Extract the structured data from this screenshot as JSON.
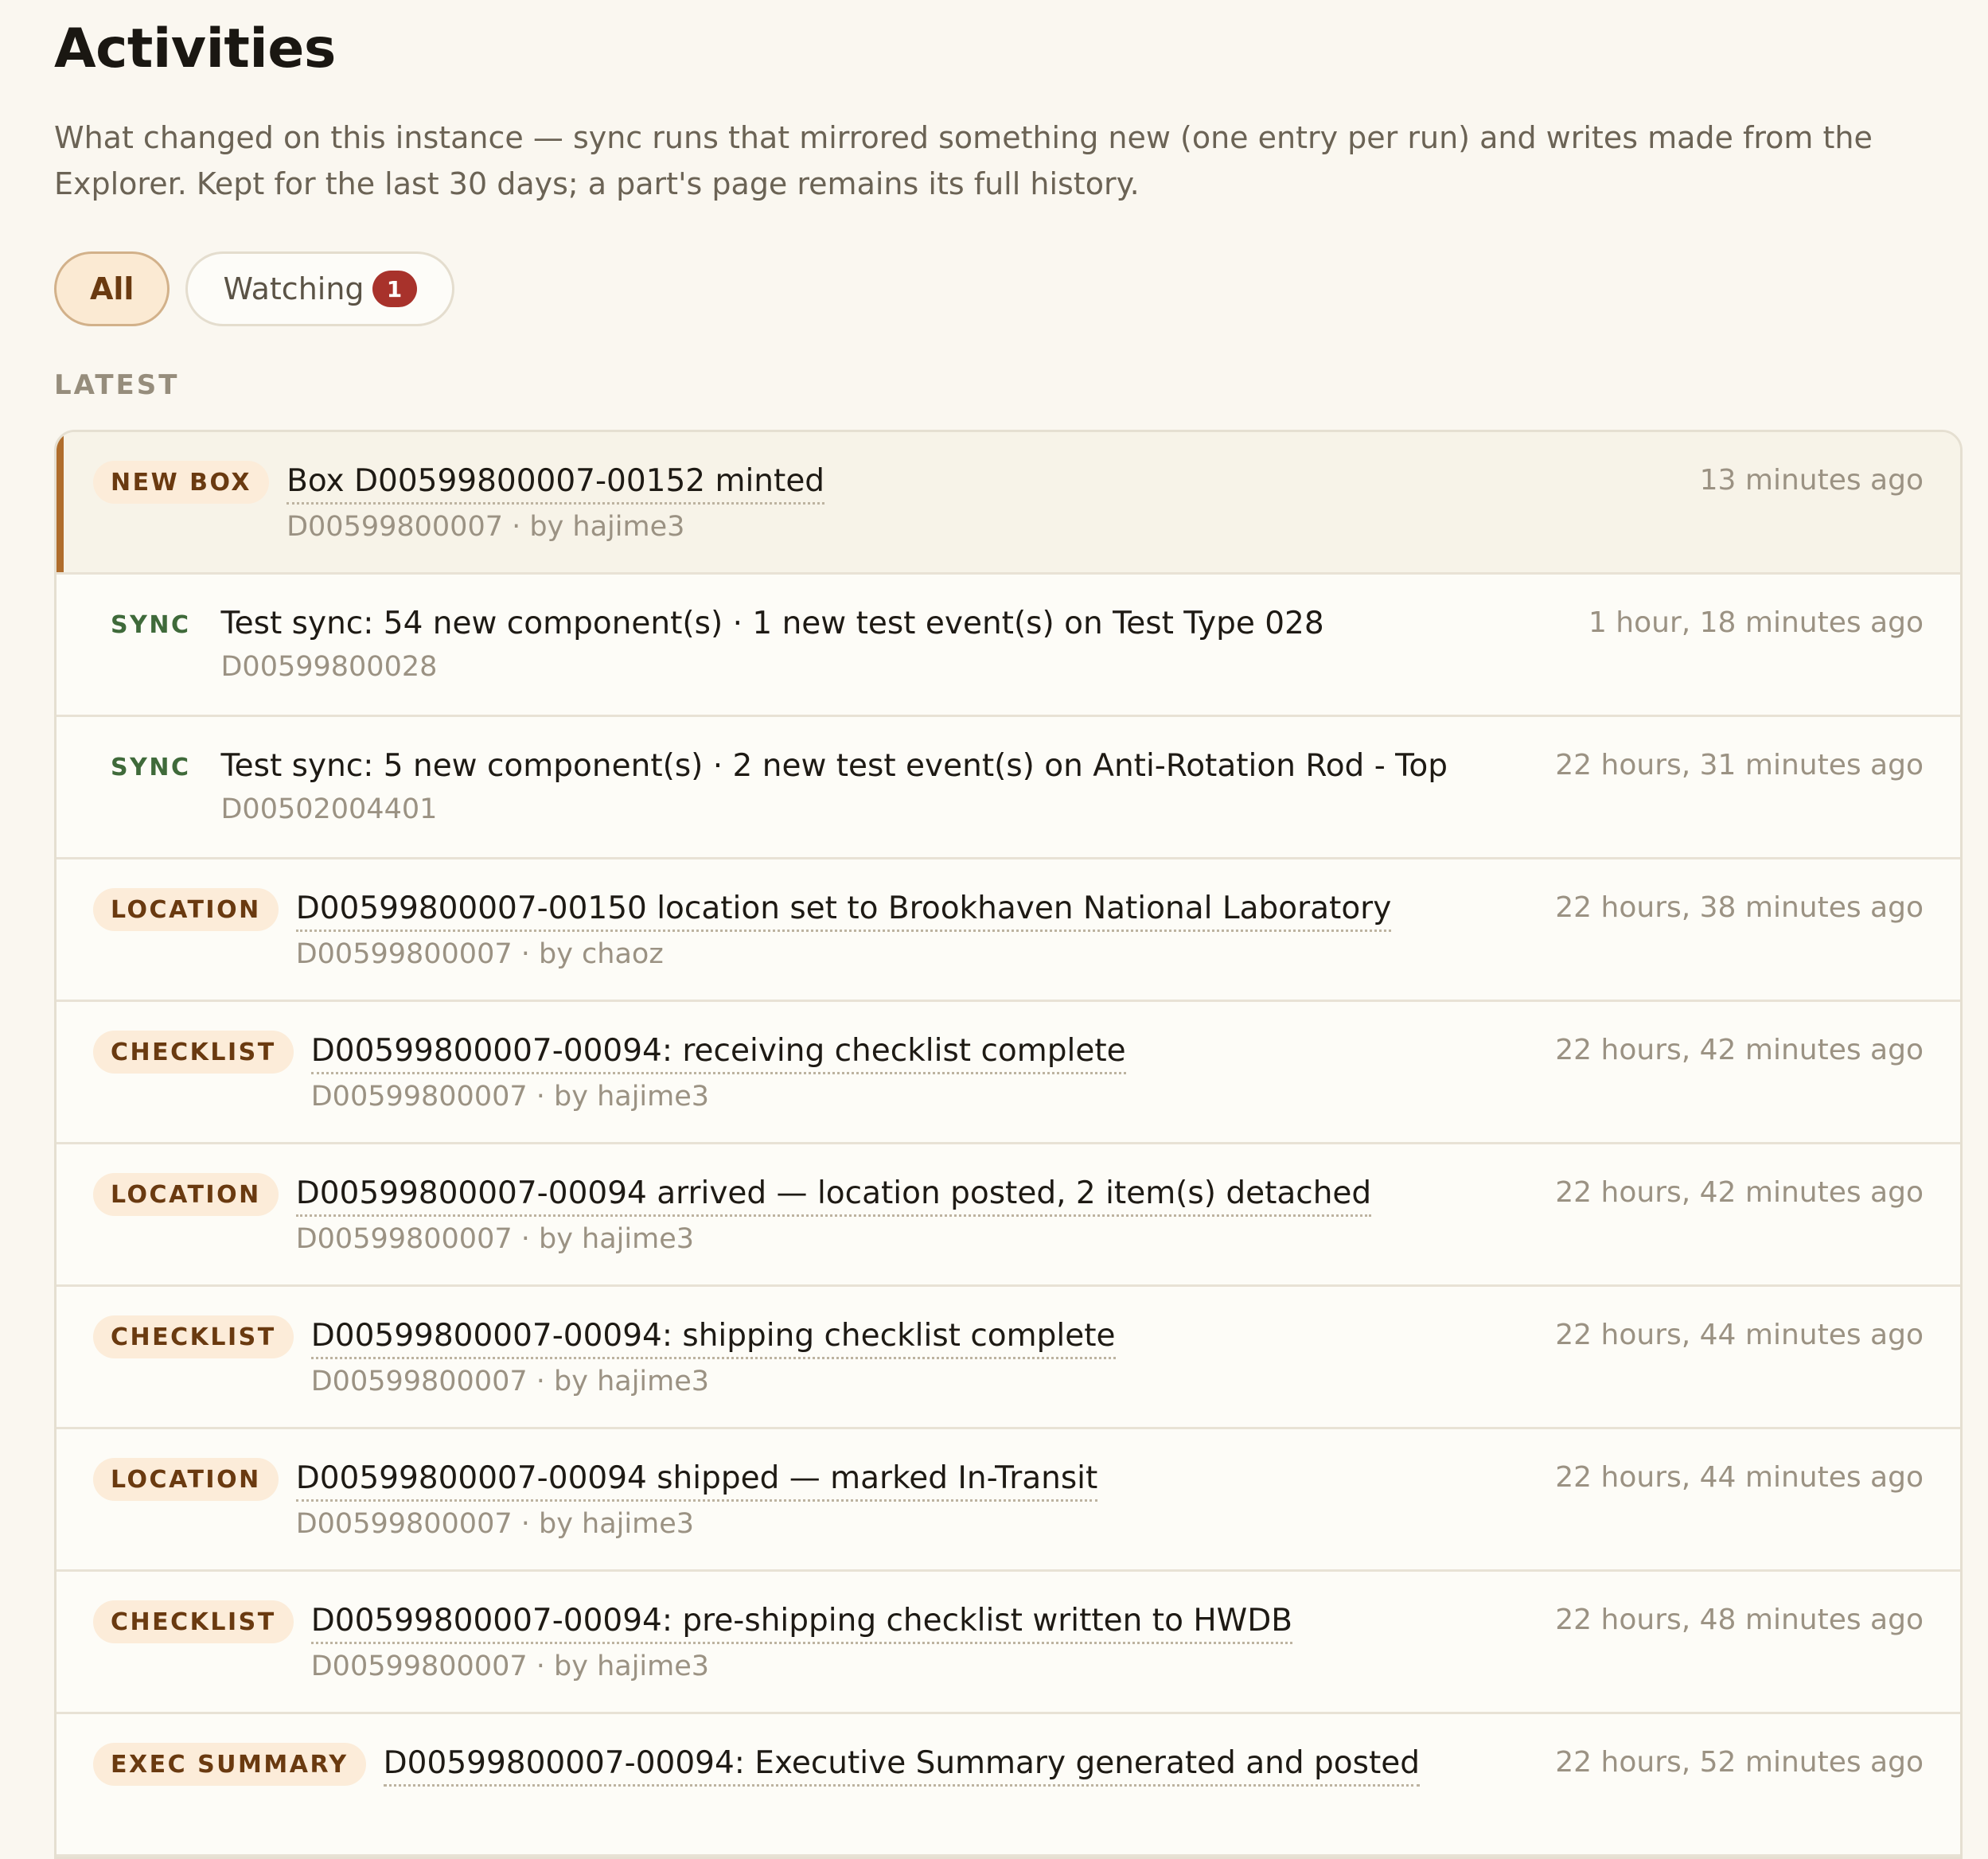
{
  "page": {
    "title": "Activities",
    "description": "What changed on this instance — sync runs that mirrored something new (one entry per run) and writes made from the Explorer. Kept for the last 30 days; a part's page remains its full history."
  },
  "filters": {
    "all_label": "All",
    "watching_label": "Watching",
    "watching_count": "1"
  },
  "section": {
    "label": "LATEST"
  },
  "activities": [
    {
      "tag": "NEW BOX",
      "headline": "Box D00599800007-00152 minted",
      "sub": "D00599800007 · by hajime3",
      "time": "13 minutes ago"
    },
    {
      "tag": "SYNC",
      "headline": "Test sync: 54 new component(s) · 1 new test event(s) on Test Type 028",
      "sub": "D00599800028",
      "time": "1 hour, 18 minutes ago"
    },
    {
      "tag": "SYNC",
      "headline": "Test sync: 5 new component(s) · 2 new test event(s) on Anti-Rotation Rod - Top",
      "sub": "D00502004401",
      "time": "22 hours, 31 minutes ago"
    },
    {
      "tag": "LOCATION",
      "headline": "D00599800007-00150 location set to Brookhaven National Laboratory",
      "sub": "D00599800007 · by chaoz",
      "time": "22 hours, 38 minutes ago"
    },
    {
      "tag": "CHECKLIST",
      "headline": "D00599800007-00094: receiving checklist complete",
      "sub": "D00599800007 · by hajime3",
      "time": "22 hours, 42 minutes ago"
    },
    {
      "tag": "LOCATION",
      "headline": "D00599800007-00094 arrived — location posted, 2 item(s) detached",
      "sub": "D00599800007 · by hajime3",
      "time": "22 hours, 42 minutes ago"
    },
    {
      "tag": "CHECKLIST",
      "headline": "D00599800007-00094: shipping checklist complete",
      "sub": "D00599800007 · by hajime3",
      "time": "22 hours, 44 minutes ago"
    },
    {
      "tag": "LOCATION",
      "headline": "D00599800007-00094 shipped — marked In-Transit",
      "sub": "D00599800007 · by hajime3",
      "time": "22 hours, 44 minutes ago"
    },
    {
      "tag": "CHECKLIST",
      "headline": "D00599800007-00094: pre-shipping checklist written to HWDB",
      "sub": "D00599800007 · by hajime3",
      "time": "22 hours, 48 minutes ago"
    },
    {
      "tag": "EXEC SUMMARY",
      "headline": "D00599800007-00094: Executive Summary generated and posted",
      "sub": "",
      "time": "22 hours, 52 minutes ago"
    }
  ]
}
